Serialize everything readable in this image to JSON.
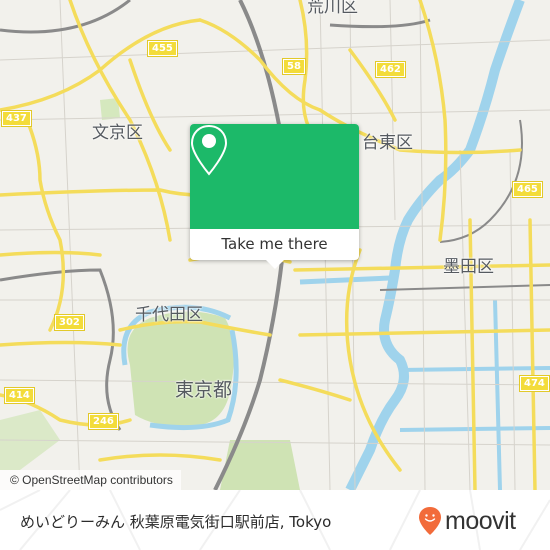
{
  "map": {
    "districts": [
      {
        "id": "bunkyo",
        "label": "文京区"
      },
      {
        "id": "taito",
        "label": "台東区"
      },
      {
        "id": "sumida",
        "label": "墨田区"
      },
      {
        "id": "chiyoda",
        "label": "千代田区"
      },
      {
        "id": "tokyo",
        "label": "東京都"
      },
      {
        "id": "arakawa",
        "label": "荒川区"
      }
    ],
    "route_shields": [
      "455",
      "437",
      "58",
      "462",
      "465",
      "302",
      "414",
      "246",
      "474"
    ],
    "attribution": "© OpenStreetMap contributors"
  },
  "popup": {
    "icon": "map-pin-icon",
    "button_label": "Take me there",
    "accent_color": "#1cb969"
  },
  "footer": {
    "place_title": "めいどりーみん 秋葉原電気街口駅前店, Tokyo",
    "brand": "moovit",
    "brand_color": "#f26b3a"
  }
}
